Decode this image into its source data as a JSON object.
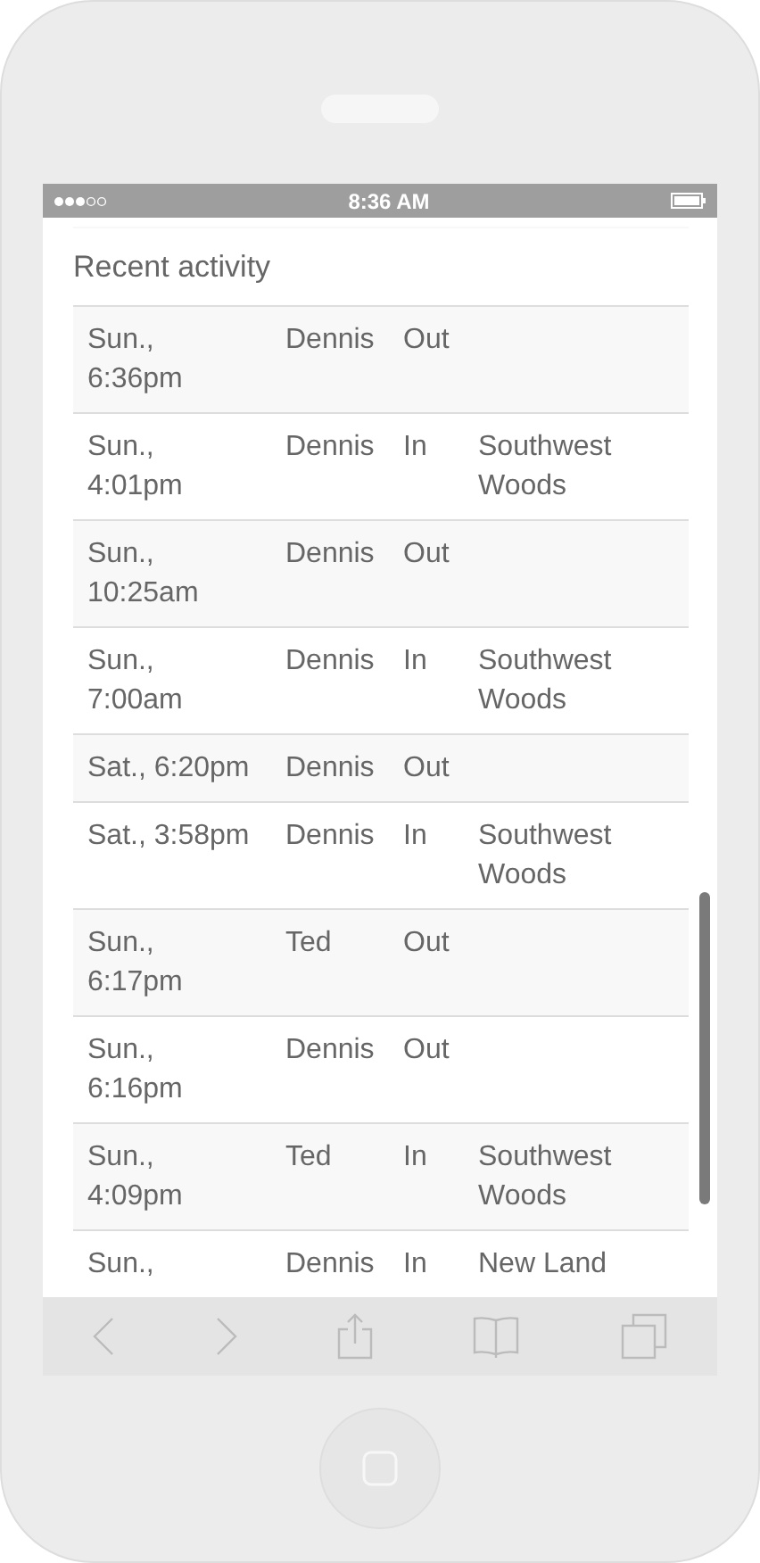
{
  "status_bar": {
    "time": "8:36 AM"
  },
  "heading": "Recent activity",
  "rows": [
    {
      "date": "Sun., 6:36pm",
      "person": "Dennis",
      "direction": "Out"
    },
    {
      "date": "Sun., 4:01pm",
      "person": "Dennis",
      "direction": "In",
      "place": "Southwest Woods"
    },
    {
      "date": "Sun., 10:25am",
      "person": "Dennis",
      "direction": "Out"
    },
    {
      "date": "Sun., 7:00am",
      "person": "Dennis",
      "direction": "In",
      "place": "Southwest Woods"
    },
    {
      "date": "Sat., 6:20pm",
      "person": "Dennis",
      "direction": "Out"
    },
    {
      "date": "Sat., 3:58pm",
      "person": "Dennis",
      "direction": "In",
      "place": "Southwest Woods"
    },
    {
      "date": "Sun., 6:17pm",
      "person": "Ted",
      "direction": "Out"
    },
    {
      "date": "Sun., 6:16pm",
      "person": "Dennis",
      "direction": "Out"
    },
    {
      "date": "Sun., 4:09pm",
      "person": "Ted",
      "direction": "In",
      "place": "Southwest Woods"
    },
    {
      "date": "Sun.,",
      "person": "Dennis",
      "direction": "In",
      "place": "New Land"
    }
  ]
}
